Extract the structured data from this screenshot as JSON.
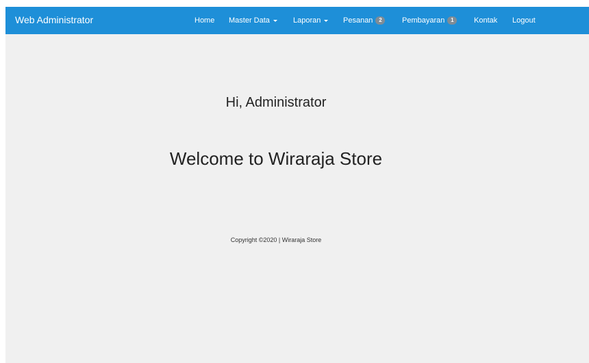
{
  "navbar": {
    "brand": "Web Administrator",
    "items": [
      {
        "label": "Home"
      },
      {
        "label": "Master Data"
      },
      {
        "label": "Laporan"
      },
      {
        "label": "Pesanan",
        "badge": "2"
      },
      {
        "label": "Pembayaran",
        "badge": "1"
      },
      {
        "label": "Kontak"
      },
      {
        "label": "Logout"
      }
    ],
    "background_color": "#1e8fd8"
  },
  "main": {
    "greeting": "Hi, Administrator",
    "welcome": "Welcome to Wiraraja Store"
  },
  "footer": {
    "copyright": "Copyright ©2020 | Wiraraja Store"
  }
}
